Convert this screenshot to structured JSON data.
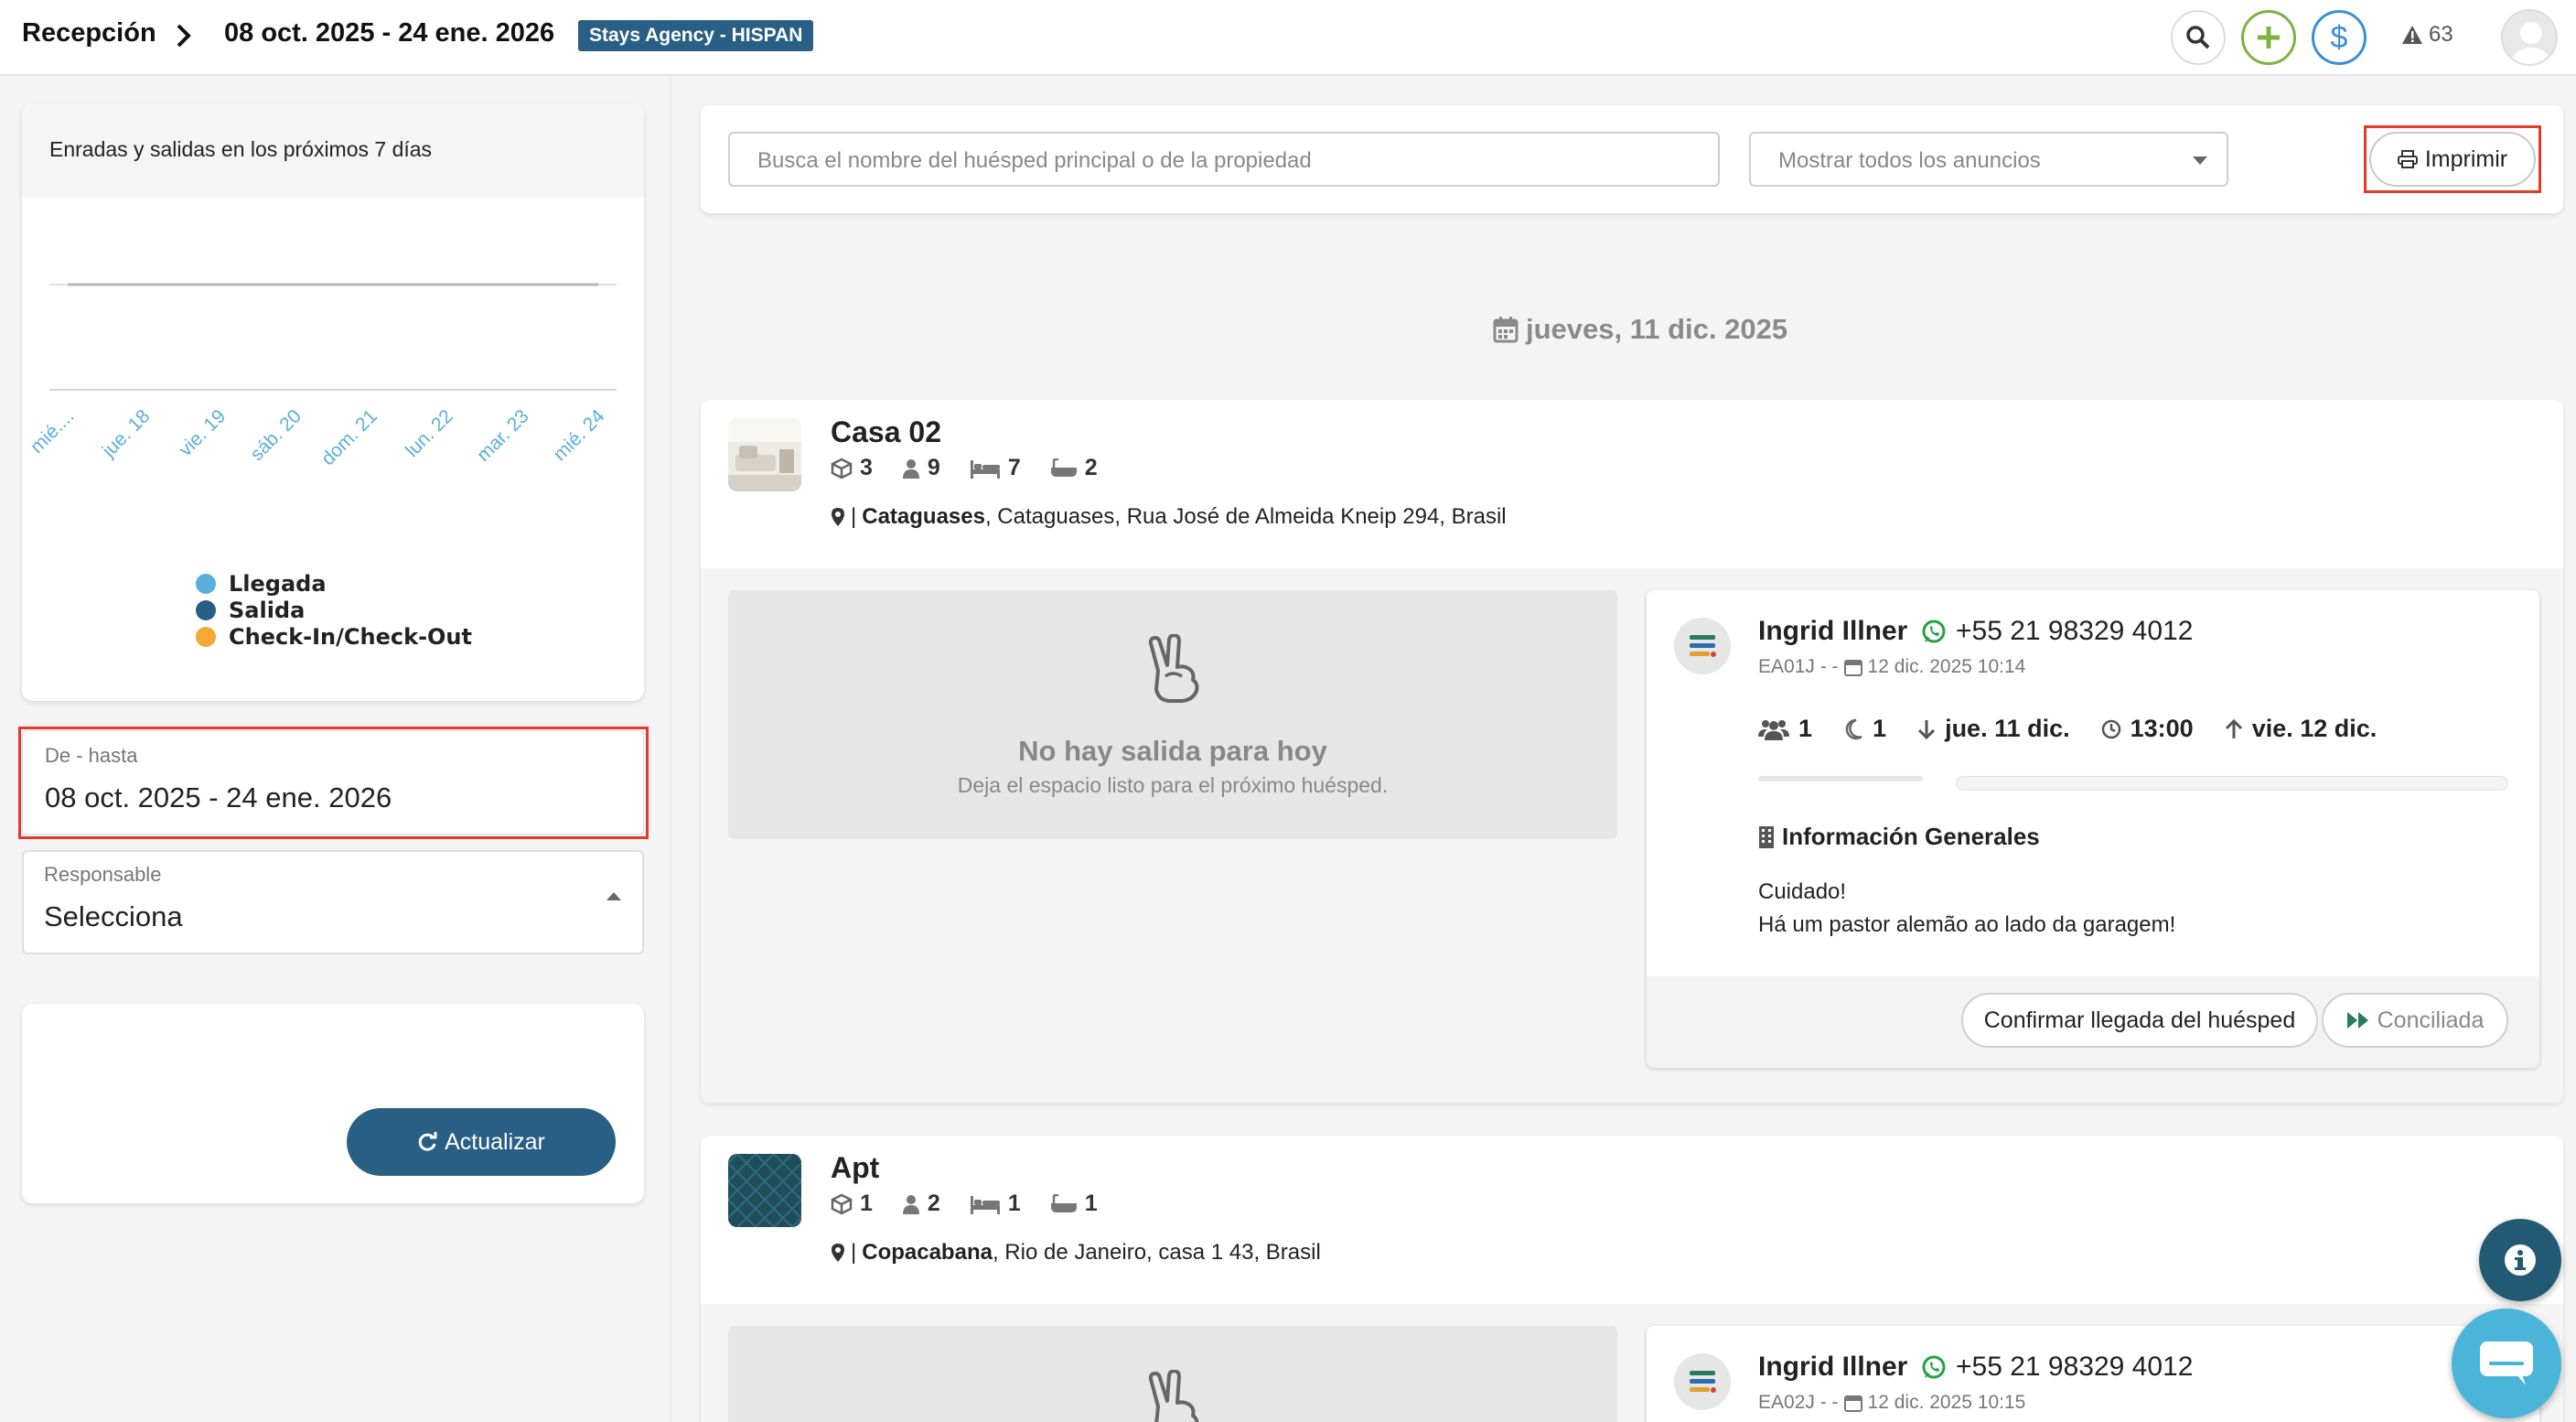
{
  "topbar": {
    "section": "Recepción",
    "date_range": "08 oct. 2025 - 24 ene. 2026",
    "agency_badge": "Stays Agency - HISPAN",
    "alerts_count": "63",
    "colors": {
      "add": "#7cb342",
      "money": "#3a8fd6",
      "badge": "#2a5f85"
    }
  },
  "sidebar": {
    "chart_card": {
      "title": "Enradas y salidas en los próximos 7 días",
      "chart_data": {
        "type": "line",
        "categories": [
          "mié....",
          "jue. 18",
          "vie. 19",
          "sáb. 20",
          "dom. 21",
          "lun. 22",
          "mar. 23",
          "mié. 24"
        ],
        "series": [
          {
            "name": "Llegada",
            "color": "#5aaedc",
            "values": [
              0,
              0,
              0,
              0,
              0,
              0,
              0,
              0
            ]
          },
          {
            "name": "Salida",
            "color": "#2a5f85",
            "values": [
              0,
              0,
              0,
              0,
              0,
              0,
              0,
              0
            ]
          },
          {
            "name": "Check-In/Check-Out",
            "color": "#f2a936",
            "values": [
              0,
              0,
              0,
              0,
              0,
              0,
              0,
              0
            ]
          }
        ],
        "legend": [
          "Llegada",
          "Salida",
          "Check-In/Check-Out"
        ],
        "grid": true
      }
    },
    "date_filter": {
      "label": "De - hasta",
      "value": "08 oct. 2025 - 24 ene. 2026"
    },
    "responsible": {
      "label": "Responsable",
      "value": "Selecciona"
    },
    "refresh_button": "Actualizar"
  },
  "filters": {
    "search_placeholder": "Busca el nombre del huésped principal o de la propiedad",
    "listing_select": "Mostrar todos los anuncios",
    "print_button": "Imprimir"
  },
  "day_header": "jueves, 11 dic. 2025",
  "properties": [
    {
      "name": "Casa 02",
      "stats": {
        "units": "3",
        "guests": "9",
        "beds": "7",
        "baths": "2"
      },
      "city": "Cataguases",
      "address": ", Cataguases, Rua José de Almeida Kneip 294, Brasil",
      "checkout_empty": {
        "title": "No hay salida para hoy",
        "subtitle": "Deja el espacio listo para el próximo huésped."
      },
      "guest": {
        "name": "Ingrid Illner",
        "phone": "+55 21 98329 4012",
        "code": "EA01J - -",
        "created": "12 dic. 2025 10:14",
        "people": "1",
        "nights": "1",
        "checkin": "jue. 11 dic.",
        "time": "13:00",
        "checkout": "vie. 12 dic.",
        "info_title": "Información Generales",
        "info_lines": [
          "Cuidado!",
          "Há um pastor alemão ao lado da garagem!"
        ],
        "confirm_button": "Confirmar llegada del huésped",
        "status_button": "Conciliada"
      }
    },
    {
      "name": "Apt",
      "stats": {
        "units": "1",
        "guests": "2",
        "beds": "1",
        "baths": "1"
      },
      "city": "Copacabana",
      "address": ", Rio de Janeiro, casa 1 43, Brasil",
      "guest": {
        "name": "Ingrid Illner",
        "phone": "+55 21 98329 4012",
        "code": "EA02J - -",
        "created": "12 dic. 2025 10:15"
      }
    }
  ]
}
